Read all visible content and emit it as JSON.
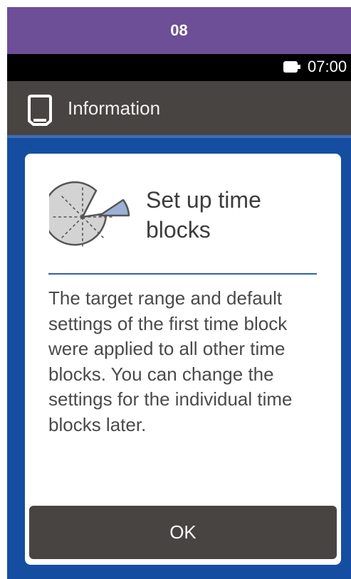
{
  "step_bar": {
    "label": "08"
  },
  "status_bar": {
    "time": "07:00",
    "battery_icon": "battery-icon"
  },
  "header": {
    "title": "Information",
    "icon": "device-icon"
  },
  "dialog": {
    "icon": "pie-chart-icon",
    "title": "Set up time blocks",
    "message": "The target range and default settings of the first time block were applied to all other time blocks. You can change the settings for the individual time blocks later.",
    "ok_label": "OK"
  },
  "colors": {
    "step_bar": "#6c4f96",
    "header": "#484442",
    "background": "#154ea1",
    "divider": "#2e64ad",
    "slice": "#9bb2d6"
  }
}
